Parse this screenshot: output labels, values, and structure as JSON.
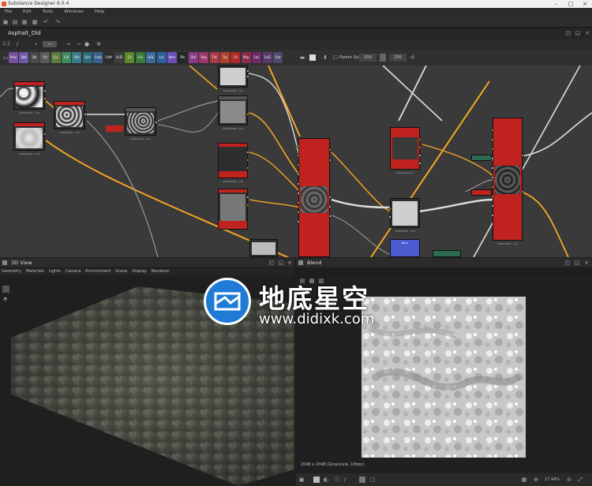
{
  "window": {
    "title": "Substance Designer 6.0.4"
  },
  "menu": [
    "File",
    "Edit",
    "Tools",
    "Windows",
    "Help"
  ],
  "graph": {
    "tab_title": "Asphalt_Old",
    "zoom": "1:1",
    "parent_size_label": "Parent Size:",
    "parent_size_value": "256",
    "size_value": "256"
  },
  "library_chips": [
    {
      "label": "Proc",
      "color": "#7a4f9e"
    },
    {
      "label": "Bld",
      "color": "#6a5aa8"
    },
    {
      "label": "Bk",
      "color": "#4a4a4a"
    },
    {
      "label": "Ctl",
      "color": "#5a5a5a"
    },
    {
      "label": "Cur",
      "color": "#5e7d3a"
    },
    {
      "label": "Cdl",
      "color": "#3e8a5a"
    },
    {
      "label": "Dtn",
      "color": "#3b7a8a"
    },
    {
      "label": "Dst",
      "color": "#2e6b7a"
    },
    {
      "label": "Cmb",
      "color": "#3a5f8f"
    },
    {
      "label": "FxM",
      "color": "#2c2c2c"
    },
    {
      "label": "GrD",
      "color": "#3e3e3e"
    },
    {
      "label": "Clr",
      "color": "#5a8a2a"
    },
    {
      "label": "Grs",
      "color": "#3c7a3c"
    },
    {
      "label": "HSL",
      "color": "#3a6a9a"
    },
    {
      "label": "Lvl",
      "color": "#2f5f9f"
    },
    {
      "label": "Nrm",
      "color": "#6a4fb8"
    },
    {
      "label": "Pix",
      "color": "#262626"
    },
    {
      "label": "Shf",
      "color": "#8a3a8a"
    },
    {
      "label": "Shp",
      "color": "#9a3a6a"
    },
    {
      "label": "Txt",
      "color": "#aa3a4a"
    },
    {
      "label": "Trp",
      "color": "#b0402a"
    },
    {
      "label": "Ch",
      "color": "#b02a2a"
    },
    {
      "label": "Wrp",
      "color": "#8a2a4a"
    },
    {
      "label": "1oC",
      "color": "#6a2a6a"
    },
    {
      "label": "1oG",
      "color": "#5a3a6a"
    },
    {
      "label": "Out",
      "color": "#4a4a6a"
    }
  ],
  "nodes": [
    {
      "title": "Blend",
      "label": "2048x2048 - L16"
    },
    {
      "title": "Warp",
      "label": "2048x2048 - L16"
    },
    {
      "title": "Blend",
      "label": "2048x2048 - L16"
    },
    {
      "title": "Blend",
      "label": "2048x2048 - L16"
    },
    {
      "title": "Blend",
      "label": "2048x2048 - L16"
    },
    {
      "title": "Blend",
      "label": "2048x2048 - L16"
    },
    {
      "title": "Blend",
      "label": "2048x2048 - L16"
    },
    {
      "title": "Material Blend",
      "label": "2048x2048 - L16"
    },
    {
      "title": "Blend",
      "label": "2048x2048 - L16"
    },
    {
      "title": "Blend",
      "label": "2048x2048 - L16"
    },
    {
      "title": "Material Blend",
      "label": "2048x2048 - L16"
    }
  ],
  "view3d": {
    "title": "3D View",
    "menu": [
      "Geometry",
      "Materials",
      "Lights",
      "Camera",
      "Environment",
      "Scene",
      "Display",
      "Renderer"
    ]
  },
  "blend": {
    "title": "Blend",
    "status": "2048 x 2048 (Grayscale, 16bpc)",
    "zoom": "17.44%"
  },
  "watermark": {
    "title": "地底星空",
    "url": "www.didixk.com"
  },
  "colors": {
    "node_red": "#c0221f",
    "wire_orange": "#f5a623",
    "canvas": "#3a3a3a"
  }
}
